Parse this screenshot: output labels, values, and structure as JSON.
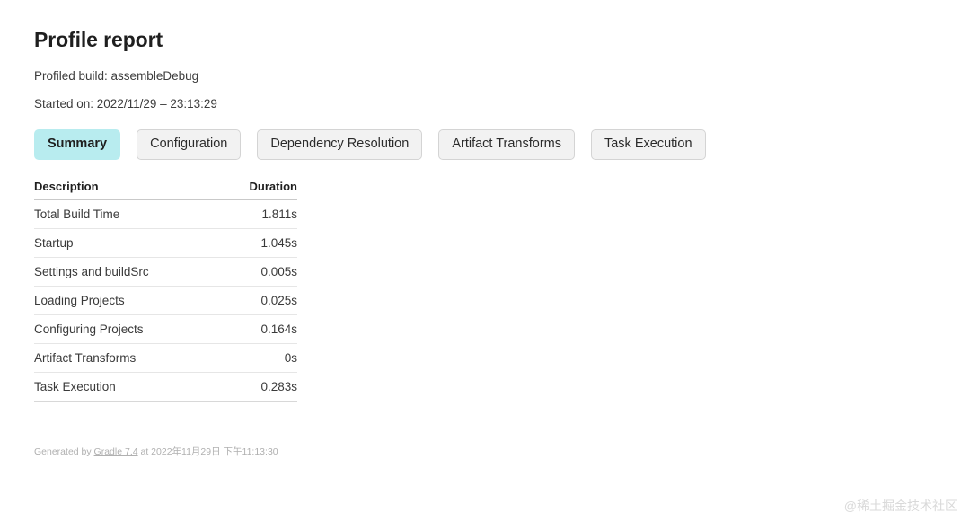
{
  "header": {
    "title": "Profile report",
    "profiled_build_label": "Profiled build: assembleDebug",
    "started_on_label": "Started on: 2022/11/29 – 23:13:29"
  },
  "tabs": [
    {
      "label": "Summary",
      "active": true
    },
    {
      "label": "Configuration",
      "active": false
    },
    {
      "label": "Dependency Resolution",
      "active": false
    },
    {
      "label": "Artifact Transforms",
      "active": false
    },
    {
      "label": "Task Execution",
      "active": false
    }
  ],
  "table": {
    "columns": [
      "Description",
      "Duration"
    ],
    "rows": [
      {
        "description": "Total Build Time",
        "duration": "1.811s"
      },
      {
        "description": "Startup",
        "duration": "1.045s"
      },
      {
        "description": "Settings and buildSrc",
        "duration": "0.005s"
      },
      {
        "description": "Loading Projects",
        "duration": "0.025s"
      },
      {
        "description": "Configuring Projects",
        "duration": "0.164s"
      },
      {
        "description": "Artifact Transforms",
        "duration": "0s"
      },
      {
        "description": "Task Execution",
        "duration": "0.283s"
      }
    ]
  },
  "footer": {
    "prefix": "Generated by ",
    "link_text": "Gradle 7.4",
    "suffix": " at 2022年11月29日 下午11:13:30"
  },
  "watermark": {
    "text": "@稀土掘金技术社区"
  },
  "colors": {
    "active_tab_background": "#b8ecef",
    "inactive_tab_background": "#f2f2f2",
    "inactive_tab_border": "#d4d4d4",
    "text": "#333333",
    "footer_text": "#b0b0b0",
    "watermark_text": "#d9d9d9"
  }
}
